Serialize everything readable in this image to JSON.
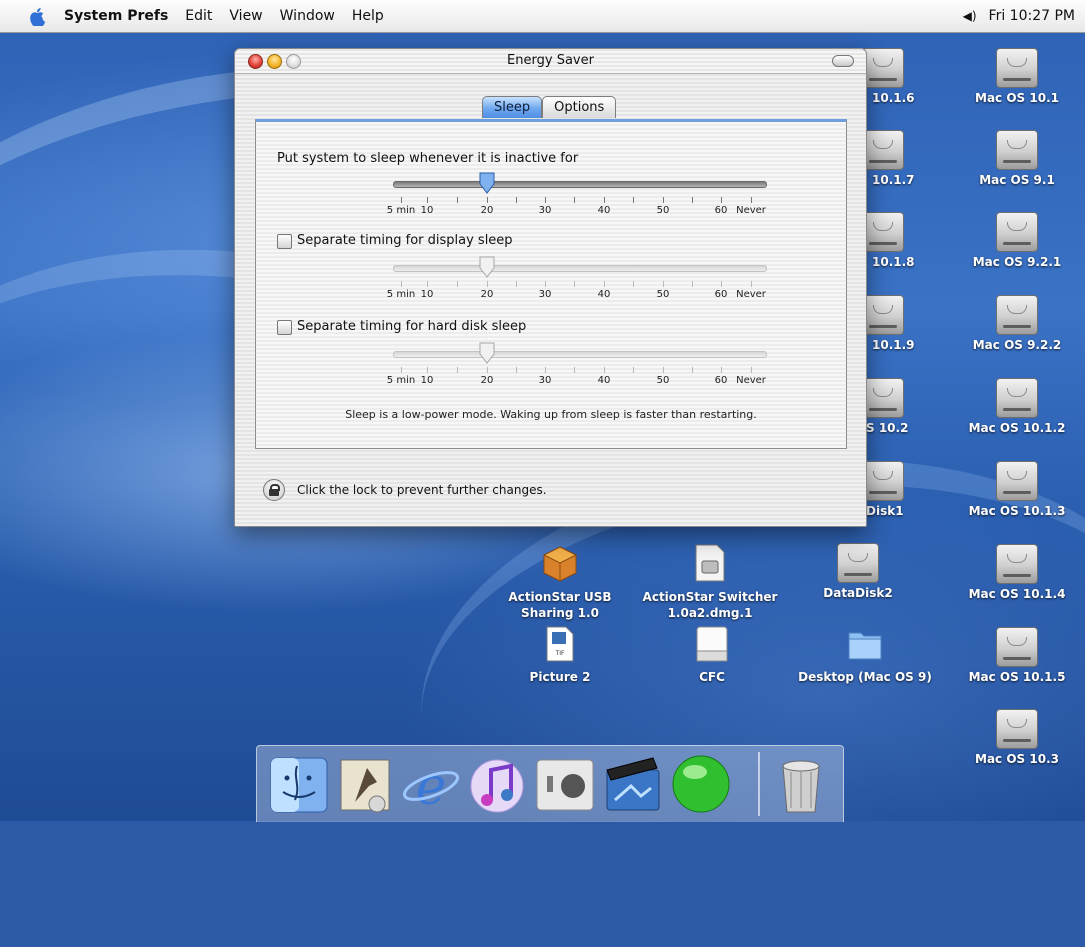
{
  "menubar": {
    "app": "System Prefs",
    "items": [
      "Edit",
      "View",
      "Window",
      "Help"
    ],
    "clock": "Fri 10:27 PM"
  },
  "desktop_icons_right": [
    {
      "label": "Mac OS 10.1"
    },
    {
      "label": "Mac OS 9.1"
    },
    {
      "label": "Mac OS 9.2.1"
    },
    {
      "label": "Mac OS 9.2.2"
    },
    {
      "label": "Mac OS 10.1.2"
    },
    {
      "label": "Mac OS 10.1.3"
    },
    {
      "label": "Mac OS 10.1.4"
    },
    {
      "label": "Mac OS 10.1.5"
    },
    {
      "label": "Mac OS 10.3"
    }
  ],
  "desktop_icons_partial": [
    "10.1.6",
    "10.1.7",
    "10.1.8",
    "10.1.9",
    "S 10.2",
    "Disk1"
  ],
  "desktop_icons_bottom": [
    {
      "label": "ActionStar USB\nSharing 1.0",
      "icon": "package-icon"
    },
    {
      "label": "ActionStar Switcher\n1.0a2.dmg.1",
      "icon": "disk-image-icon"
    },
    {
      "label": "DataDisk2",
      "icon": "hard-drive-icon"
    },
    {
      "label": "Picture 2",
      "icon": "tiff-file-icon"
    },
    {
      "label": "CFC",
      "icon": "removable-disk-icon"
    },
    {
      "label": "Desktop (Mac OS 9)",
      "icon": "folder-icon"
    }
  ],
  "window": {
    "title": "Energy Saver",
    "tabs": [
      {
        "label": "Sleep",
        "active": true
      },
      {
        "label": "Options",
        "active": false
      }
    ],
    "system_sleep_label": "Put system to sleep whenever it is inactive for",
    "display_sleep_label": "Separate timing for display sleep",
    "disk_sleep_label": "Separate timing for hard disk sleep",
    "display_sleep_checked": false,
    "disk_sleep_checked": false,
    "scale_labels": [
      "5 min",
      "10",
      "20",
      "30",
      "40",
      "50",
      "60",
      "Never"
    ],
    "system_sleep_value": "20",
    "display_sleep_value": "20",
    "disk_sleep_value": "20",
    "footnote": "Sleep is a low-power mode. Waking up from sleep is faster than restarting.",
    "lock_text": "Click the lock to prevent further changes."
  },
  "dock_items": [
    "finder-icon",
    "mail-icon",
    "internet-explorer-icon",
    "itunes-icon",
    "system-preferences-icon",
    "imovie-icon",
    "green-orb-icon",
    "trash-icon"
  ],
  "colors": {
    "desktop": "#2f63b6",
    "tab_active": "#6fa8ef",
    "window_stripe": "#e4e4e4"
  }
}
